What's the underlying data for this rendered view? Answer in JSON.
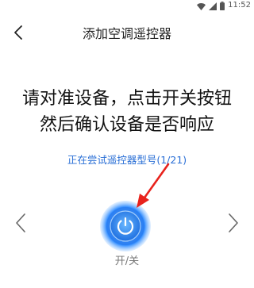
{
  "status_bar": {
    "time": "11:52",
    "icons": [
      "wifi-icon",
      "signal-icon",
      "battery-icon"
    ]
  },
  "header": {
    "title": "添加空调遥控器",
    "back_icon": "chevron-left-icon"
  },
  "main": {
    "instruction_line1": "请对准设备，点击开关按钮",
    "instruction_line2": "然后确认设备是否响应",
    "trying_text": "正在尝试遥控器型号(1/21)",
    "power_label": "开/关",
    "prev_icon": "chevron-left-icon",
    "next_icon": "chevron-right-icon",
    "power_icon": "power-icon"
  },
  "colors": {
    "accent_blue": "#2a6fd6",
    "power_glow": "#3b9bff",
    "pointer_red": "#e8221c"
  }
}
